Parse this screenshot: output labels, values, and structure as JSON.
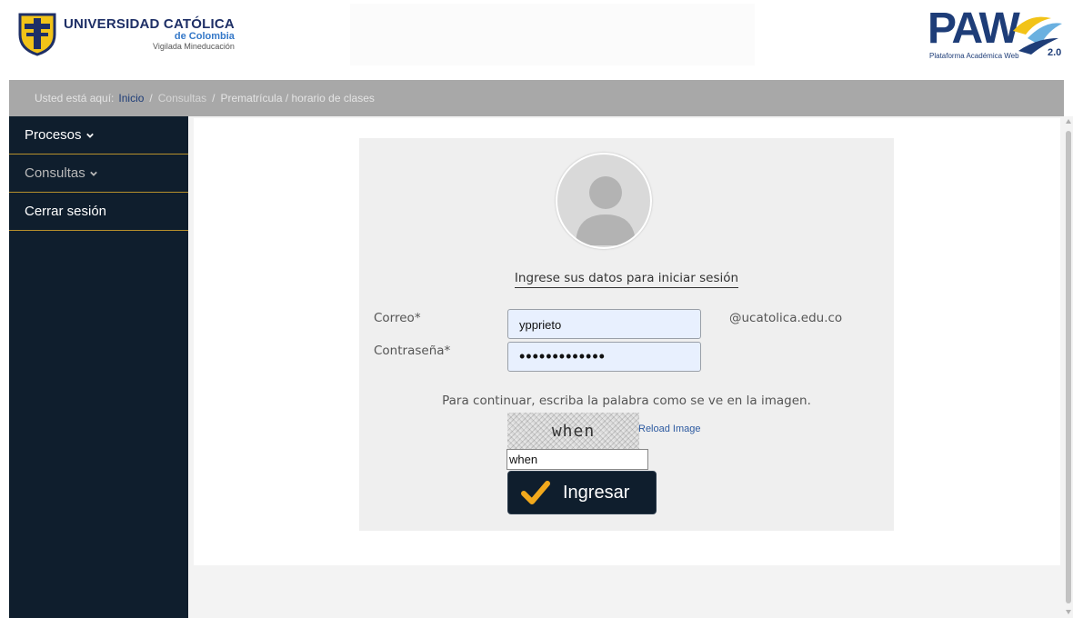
{
  "header": {
    "university": {
      "name_part1": "UNIVERSIDAD",
      "name_part2": "CATÓLICA",
      "subname": "de Colombia",
      "tagline": "Vigilada Mineducación",
      "logo_icon": "university-shield-icon"
    },
    "paw": {
      "word": "PAW",
      "subtitle": "Plataforma Académica Web",
      "version": "2.0",
      "logo_icon": "paw-emblem-icon"
    }
  },
  "breadcrumb": {
    "label": "Usted está aquí:",
    "items": [
      "Inicio",
      "Consultas"
    ],
    "separator": "/",
    "current": "Prematrícula / horario de clases"
  },
  "sidebar": {
    "items": [
      {
        "label": "Procesos",
        "icon": "chevron-down-icon"
      },
      {
        "label": "Consultas",
        "icon": "chevron-down-icon"
      },
      {
        "label": "Cerrar sesión"
      }
    ]
  },
  "login": {
    "avatar_icon": "user-avatar-icon",
    "title": "Ingrese sus datos para iniciar sesión",
    "email_label": "Correo*",
    "email_value": "ypprieto",
    "email_suffix": "@ucatolica.edu.co",
    "password_label": "Contraseña*",
    "password_value": "•••••••••••••",
    "captcha_instructions": "Para continuar, escriba la palabra como se ve en la imagen.",
    "captcha_word": "when",
    "reload_label": "Reload Image",
    "captcha_input_value": "when",
    "submit_label": "Ingresar",
    "submit_icon": "checkmark-icon"
  },
  "colors": {
    "navy": "#0f1e2d",
    "gold": "#f2a91c",
    "divider": "#b68f2c",
    "breadcrumb_bg": "#a8a8a8",
    "brand_blue": "#1e3d78"
  }
}
